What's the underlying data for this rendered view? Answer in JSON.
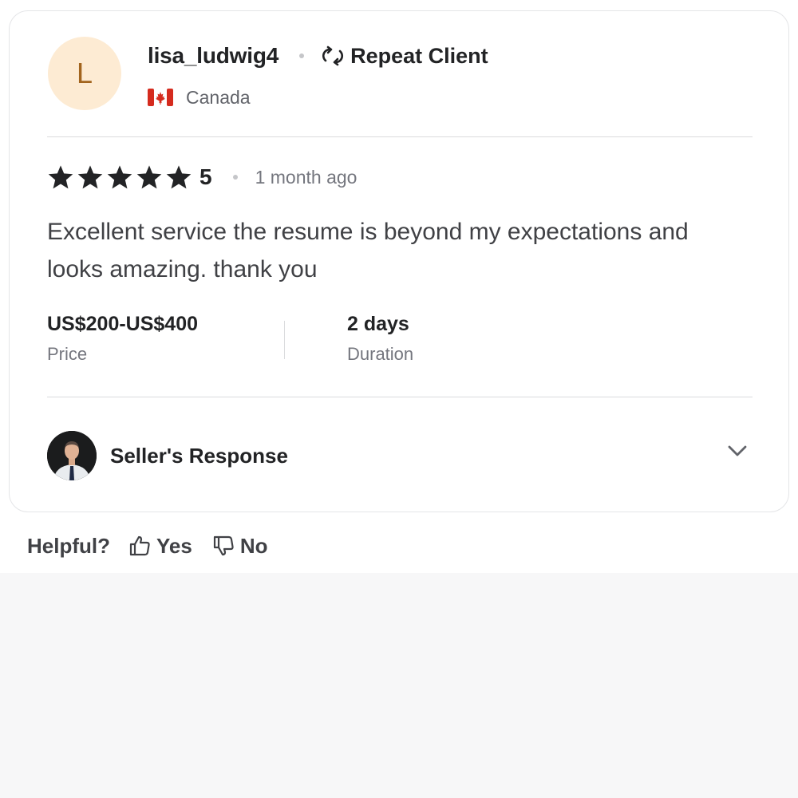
{
  "review": {
    "avatar_initial": "L",
    "username": "lisa_ludwig4",
    "badge_label": "Repeat Client",
    "badge_icon": "repeat-icon",
    "country": "Canada",
    "country_flag": "canada-flag-icon",
    "rating": 5,
    "rating_label": "5",
    "time_ago": "1 month ago",
    "text": "Excellent service the resume is beyond my expectations and looks amazing. thank you",
    "price_value": "US$200-US$400",
    "price_label": "Price",
    "duration_value": "2 days",
    "duration_label": "Duration",
    "seller_response_label": "Seller's Response"
  },
  "helpful": {
    "label": "Helpful?",
    "yes_label": "Yes",
    "no_label": "No"
  },
  "colors": {
    "avatar_bg": "#fdebd3",
    "avatar_text": "#a2641d",
    "star": "#222325",
    "page_bg_bottom": "#f7f7f8"
  }
}
